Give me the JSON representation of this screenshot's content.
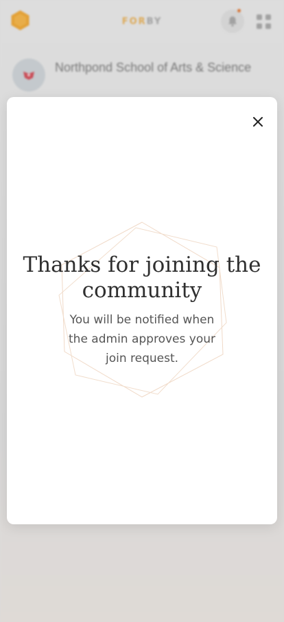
{
  "app": {
    "brand_part1": "FOR",
    "brand_part2": "BY",
    "brand_accent_color": "#e8b15a",
    "logo_icon": "hexagon-logo-icon",
    "notification_icon": "bell-icon",
    "menu_icon": "grid-icon",
    "notification_dot_color": "#e07b39"
  },
  "community": {
    "name": "Northpond School of  Arts & Science",
    "avatar_icon": "school-crest-icon"
  },
  "modal": {
    "title": "Thanks for joining the community",
    "message": "You will be notified when the admin approves your join request.",
    "close_icon": "close-icon"
  }
}
